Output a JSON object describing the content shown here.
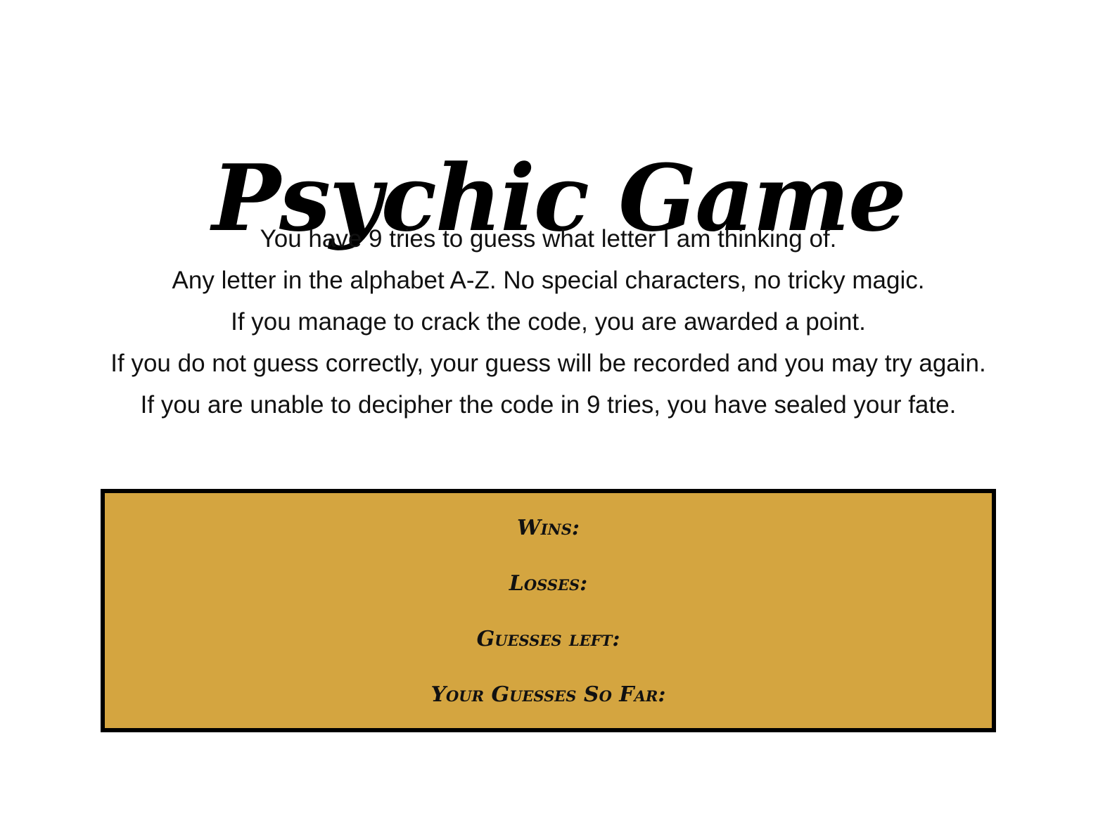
{
  "title": "Psychic Game",
  "intro": {
    "line1": "You have 9 tries to guess what letter I am thinking of.",
    "line2": "Any letter in the alphabet A-Z. No special characters, no tricky magic.",
    "line3": "If you manage to crack the code, you are awarded a point.",
    "line4": "If you do not guess correctly, your guess will be recorded and you may try again. If you are unable to decipher the code in 9 tries, you have sealed your fate."
  },
  "stats": {
    "wins_label": "Wins:",
    "losses_label": "Losses:",
    "guesses_left_label": "Guesses left:",
    "guesses_so_far_label": "Your Guesses So Far:"
  },
  "colors": {
    "panel": "#D4A540",
    "border": "#000000"
  }
}
